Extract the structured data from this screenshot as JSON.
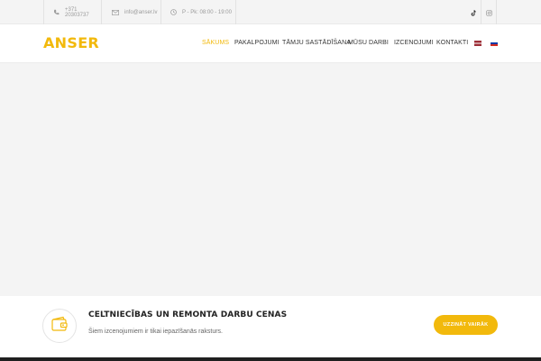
{
  "topbar": {
    "phone": "+371 20303737",
    "email": "info@anser.lv",
    "hours": "P - Pk: 08:00 - 19:00"
  },
  "header": {
    "logo": "ANSER",
    "nav": [
      {
        "label": "SĀKUMS",
        "active": true
      },
      {
        "label": "PAKALPOJUMI",
        "active": false
      },
      {
        "label": "TĀMJU SASTĀDĪŠANA",
        "active": false
      },
      {
        "label": "MŪSU DARBI",
        "active": false
      },
      {
        "label": "IZCENOJUMI",
        "active": false
      },
      {
        "label": "KONTAKTI",
        "active": false
      }
    ]
  },
  "banner": {
    "title": "CELTNIECĪBAS UN REMONTA DARBU CENAS",
    "subtitle": "Šiem izcenojumiem ir tikai iepazīšanās raksturs.",
    "button": "UZZINĀT VAIRĀK"
  },
  "colors": {
    "accent": "#f2b90c",
    "background": "#f4f4f4"
  }
}
